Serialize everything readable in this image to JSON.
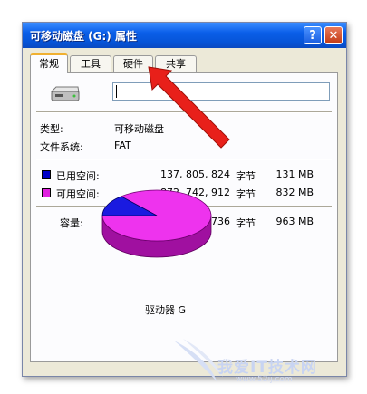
{
  "window": {
    "title": "可移动磁盘 (G:) 属性",
    "help_label": "?",
    "close_label": "✕"
  },
  "tabs": [
    {
      "label": "常规",
      "active": true
    },
    {
      "label": "工具",
      "active": false
    },
    {
      "label": "硬件",
      "active": false
    },
    {
      "label": "共享",
      "active": false
    }
  ],
  "general": {
    "icon": "removable-drive-icon",
    "name_value": "",
    "type_label": "类型:",
    "type_value": "可移动磁盘",
    "fs_label": "文件系统:",
    "fs_value": "FAT",
    "used": {
      "label": "已用空间:",
      "bytes": "137, 805, 824",
      "unit": "字节",
      "size": "131 MB",
      "color": "#0000c8"
    },
    "free": {
      "label": "可用空间:",
      "bytes": "872, 742, 912",
      "unit": "字节",
      "size": "832 MB",
      "color": "#e020e0"
    },
    "capacity": {
      "label": "容量:",
      "bytes": "1, 010, 548, 736",
      "unit": "字节",
      "size": "963 MB"
    },
    "drive_label": "驱动器 G",
    "used_fraction": 0.1364
  },
  "annotation": {
    "arrow_color": "#e8201a",
    "points_to": "硬件"
  },
  "watermark": {
    "text": "我爱IT技术网",
    "url": "www.52ij.com"
  }
}
